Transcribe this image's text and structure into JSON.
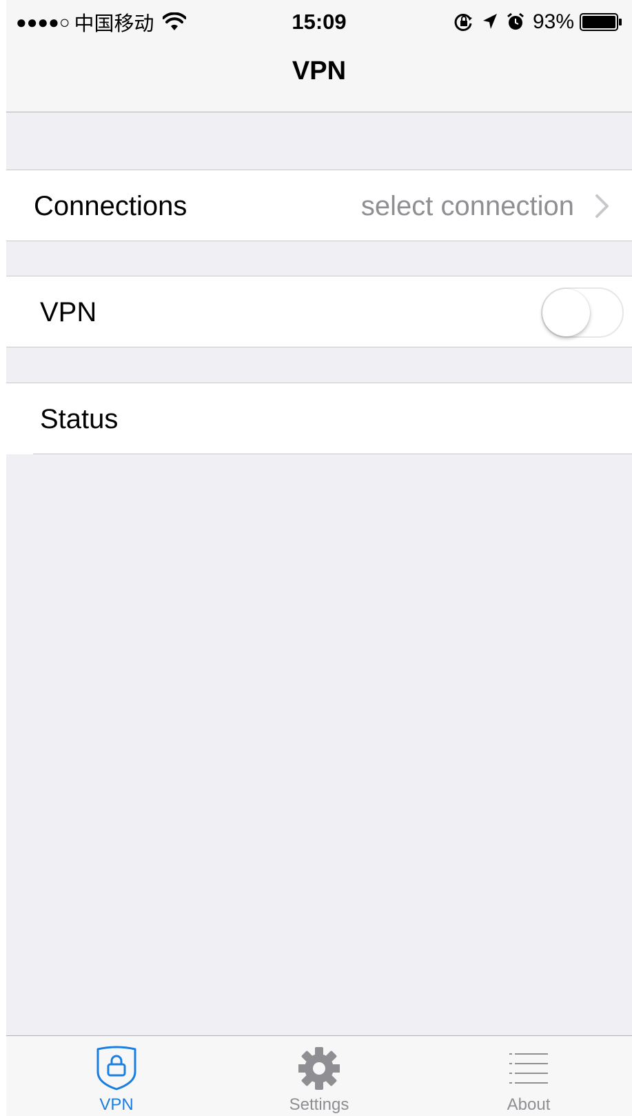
{
  "status_bar": {
    "signal": "●●●●○",
    "carrier": "中国移动",
    "time": "15:09",
    "battery": "93%",
    "icons": [
      "wifi-icon",
      "orientation-lock-icon",
      "location-arrow-icon",
      "alarm-icon",
      "battery-icon"
    ]
  },
  "nav": {
    "title": "VPN"
  },
  "cells": {
    "connections": {
      "label": "Connections",
      "detail": "select connection"
    },
    "vpn": {
      "label": "VPN",
      "toggle_on": false
    },
    "status": {
      "label": "Status"
    }
  },
  "tabs": [
    {
      "label": "VPN",
      "icon": "shield-lock-icon",
      "selected": true
    },
    {
      "label": "Settings",
      "icon": "gear-icon",
      "selected": false
    },
    {
      "label": "About",
      "icon": "list-icon",
      "selected": false
    }
  ],
  "colors": {
    "accent": "#1a7ee0",
    "tab_inactive": "#8e8e93",
    "detail_text": "#8e8e93",
    "grouped_background": "#efeff4"
  }
}
